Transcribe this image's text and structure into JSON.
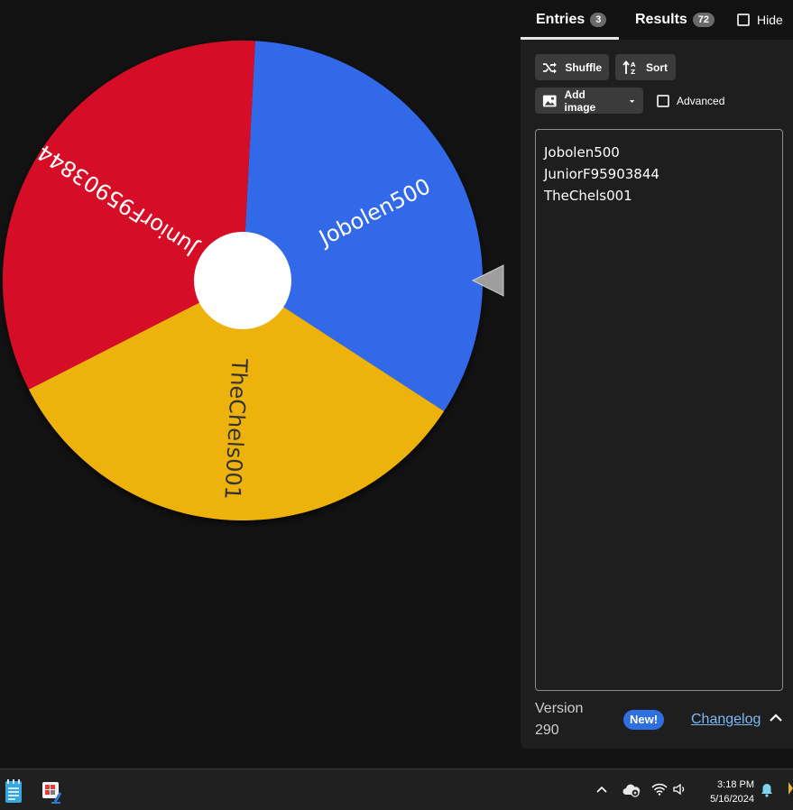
{
  "wheel": {
    "segments": [
      {
        "label": "Jobolen500",
        "color": "#3369e8"
      },
      {
        "label": "TheChels001",
        "color": "#eeb211"
      },
      {
        "label": "JuniorF95903844",
        "color": "#d50f25"
      }
    ],
    "pointer_icon": "pointer-triangle-icon"
  },
  "tabs": {
    "entries_label": "Entries",
    "entries_count": "3",
    "results_label": "Results",
    "results_count": "72",
    "hide_label": "Hide"
  },
  "toolbar": {
    "shuffle_label": "Shuffle",
    "sort_label": "Sort",
    "add_image_label": "Add image",
    "advanced_label": "Advanced"
  },
  "entries": [
    "Jobolen500",
    "JuniorF95903844",
    "TheChels001"
  ],
  "footer": {
    "version_label": "Version",
    "version_number": "290",
    "new_badge": "New!",
    "changelog_label": "Changelog"
  },
  "taskbar": {
    "time": "3:18 PM",
    "date": "5/16/2024"
  }
}
